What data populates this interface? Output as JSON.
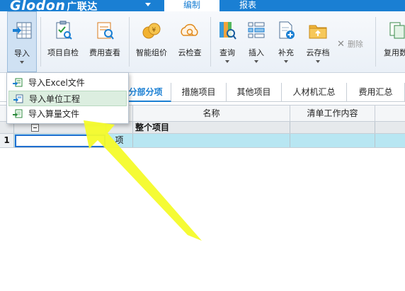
{
  "app": {
    "logo": "Glodon",
    "logo_cn": "广联达",
    "tabs": [
      {
        "label": "编制",
        "active": true
      },
      {
        "label": "报表",
        "active": false
      }
    ]
  },
  "ribbon": {
    "buttons": [
      {
        "name": "import-button",
        "label": "导入",
        "icon": "import-grid-icon",
        "has_dropdown": true,
        "pressed": true
      },
      {
        "name": "project-check-button",
        "label": "项目自检",
        "icon": "checklist-icon",
        "has_dropdown": false
      },
      {
        "name": "cost-view-button",
        "label": "费用查看",
        "icon": "cost-search-icon",
        "has_dropdown": false
      },
      {
        "name": "smart-pricing-button",
        "label": "智能组价",
        "icon": "coins-icon",
        "has_dropdown": false
      },
      {
        "name": "cloud-check-button",
        "label": "云检查",
        "icon": "cloud-search-icon",
        "has_dropdown": false
      },
      {
        "name": "query-button",
        "label": "查询",
        "icon": "book-search-icon",
        "has_dropdown": true
      },
      {
        "name": "insert-button",
        "label": "插入",
        "icon": "insert-rows-icon",
        "has_dropdown": true
      },
      {
        "name": "supplement-button",
        "label": "补充",
        "icon": "add-doc-icon",
        "has_dropdown": true
      },
      {
        "name": "cloud-archive-button",
        "label": "云存档",
        "icon": "cloud-folder-icon",
        "has_dropdown": true
      },
      {
        "name": "reuse-button",
        "label": "复用数",
        "icon": "reuse-icon",
        "has_dropdown": false
      }
    ],
    "delete_label": "删除"
  },
  "dropdown": {
    "items": [
      {
        "label": "导入Excel文件",
        "icon": "excel-import-icon",
        "highlighted": false
      },
      {
        "label": "导入单位工程",
        "icon": "unit-import-icon",
        "highlighted": true
      },
      {
        "label": "导入算量文件",
        "icon": "quantity-import-icon",
        "highlighted": false
      }
    ]
  },
  "sheet_tabs": [
    {
      "label": "分部分项",
      "active": true
    },
    {
      "label": "措施项目",
      "active": false
    },
    {
      "label": "其他项目",
      "active": false
    },
    {
      "label": "人材机汇总",
      "active": false
    },
    {
      "label": "费用汇总",
      "active": false
    }
  ],
  "grid": {
    "columns": [
      "名称",
      "清单工作内容"
    ],
    "rows": [
      {
        "num": "",
        "type": "",
        "name": "整个项目"
      },
      {
        "num": "1",
        "type": "项",
        "name": ""
      }
    ]
  },
  "colors": {
    "brand": "#1a7fd3",
    "highlight_row": "#b8e6f2",
    "arrow": "#f4fb2a"
  }
}
